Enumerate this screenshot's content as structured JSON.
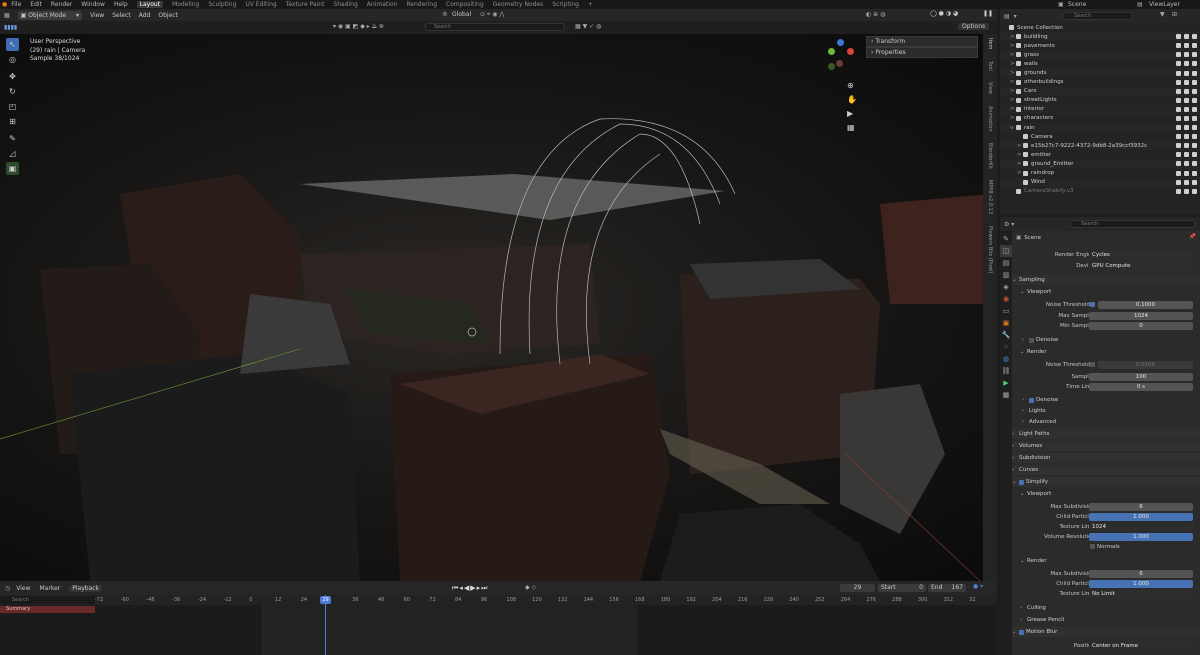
{
  "menubar": {
    "items": [
      "File",
      "Edit",
      "Render",
      "Window",
      "Help"
    ],
    "workspaces": [
      "Layout",
      "Modeling",
      "Sculpting",
      "UV Editing",
      "Texture Paint",
      "Shading",
      "Animation",
      "Rendering",
      "Compositing",
      "Geometry Nodes",
      "Scripting"
    ],
    "scene": "Scene",
    "view_layer": "ViewLayer"
  },
  "viewport": {
    "mode": "Object Mode",
    "menus": [
      "View",
      "Select",
      "Add",
      "Object"
    ],
    "orientation": "Global",
    "overlay": {
      "line1": "User Perspective",
      "line2": "(29) rain | Camera",
      "line3": "Sample 38/1024"
    },
    "options": "Options",
    "npanel": [
      "Transform",
      "Properties"
    ],
    "side_tabs": [
      "Item",
      "Tool",
      "View",
      "Animation",
      "BlenderKit",
      "MPFB v2.0.13",
      "Flowers Bits (Pixel)"
    ],
    "gizmo": {
      "x": "X",
      "y": "Y",
      "z": "Z"
    }
  },
  "timeline": {
    "menus": [
      "View",
      "Marker"
    ],
    "playback": "Playback",
    "current_frame": "29",
    "start_label": "Start",
    "start": "0",
    "end_label": "End",
    "end": "167",
    "search_placeholder": "Search",
    "summary": "Summary",
    "ticks": [
      "-72",
      "-60",
      "-48",
      "-36",
      "-24",
      "-12",
      "0",
      "12",
      "24",
      "29",
      "36",
      "48",
      "60",
      "72",
      "84",
      "96",
      "108",
      "120",
      "132",
      "144",
      "156",
      "168",
      "180",
      "192",
      "204",
      "216",
      "228",
      "240",
      "252",
      "264",
      "276",
      "288",
      "300",
      "312",
      "32"
    ]
  },
  "outliner": {
    "search_placeholder": "Search",
    "rows": [
      {
        "name": "Scene Collection",
        "indent": 0,
        "expander": "",
        "color": "#cfcfcf"
      },
      {
        "name": "buildling",
        "indent": 1,
        "expander": ">",
        "color": "#cfcfcf"
      },
      {
        "name": "pavements",
        "indent": 1,
        "expander": ">",
        "color": "#cfcfcf"
      },
      {
        "name": "grass",
        "indent": 1,
        "expander": ">",
        "color": "#cfcfcf"
      },
      {
        "name": "walls",
        "indent": 1,
        "expander": ">",
        "color": "#cfcfcf"
      },
      {
        "name": "grounds",
        "indent": 1,
        "expander": ">",
        "color": "#cfcfcf"
      },
      {
        "name": "otherbuildings",
        "indent": 1,
        "expander": ">",
        "color": "#cfcfcf"
      },
      {
        "name": "Cars",
        "indent": 1,
        "expander": ">",
        "color": "#cfcfcf"
      },
      {
        "name": "streetLights",
        "indent": 1,
        "expander": ">",
        "color": "#cfcfcf"
      },
      {
        "name": "interior",
        "indent": 1,
        "expander": ">",
        "color": "#cfcfcf"
      },
      {
        "name": "characters",
        "indent": 1,
        "expander": ">",
        "color": "#cfcfcf"
      },
      {
        "name": "rain",
        "indent": 1,
        "expander": "v",
        "color": "#cfcfcf"
      },
      {
        "name": "Camera",
        "indent": 2,
        "expander": "",
        "color": "#cfcfcf"
      },
      {
        "name": "e15b27c7-9222-4372-9db8-2a39ccf3932c",
        "indent": 2,
        "expander": ">",
        "color": "#cfcfcf"
      },
      {
        "name": "emitter",
        "indent": 2,
        "expander": ">",
        "color": "#cfcfcf"
      },
      {
        "name": "ground_Emitter",
        "indent": 2,
        "expander": ">",
        "color": "#cfcfcf"
      },
      {
        "name": "raindrop",
        "indent": 2,
        "expander": ">",
        "color": "#cfcfcf"
      },
      {
        "name": "Wind",
        "indent": 2,
        "expander": "",
        "color": "#cfcfcf"
      },
      {
        "name": "CameraShakify.v3",
        "indent": 1,
        "expander": "",
        "color": "#777"
      }
    ]
  },
  "properties": {
    "search_placeholder": "Search",
    "context": "Scene",
    "render_engine_label": "Render Engine",
    "render_engine": "Cycles",
    "device_label": "Device",
    "device": "GPU Compute",
    "sampling": "Sampling",
    "viewport": "Viewport",
    "noise_threshold_label": "Noise Threshold",
    "vp_noise_threshold": "0.1000",
    "max_samples_label": "Max Samples",
    "vp_max_samples": "1024",
    "min_samples_label": "Min Samples",
    "vp_min_samples": "0",
    "denoise": "Denoise",
    "render": "Render",
    "r_noise_threshold": "0.0100",
    "samples_label": "Samples",
    "r_samples": "100",
    "time_limit_label": "Time Limit",
    "r_time_limit": "0 s",
    "lights": "Lights",
    "advanced": "Advanced",
    "light_paths": "Light Paths",
    "volumes": "Volumes",
    "subdivision": "Subdivision",
    "curves": "Curves",
    "simplify": "Simplify",
    "max_subdivision_label": "Max Subdivision",
    "vp_max_subdivision": "6",
    "child_particles_label": "Child Particles",
    "vp_child_particles": "1.000",
    "texture_limit_label": "Texture Limit",
    "vp_texture_limit": "1024",
    "volume_resolution_label": "Volume Resolution",
    "vp_volume_resolution": "1.000",
    "normals": "Normals",
    "r_max_subdivision": "6",
    "r_child_particles": "1.000",
    "r_texture_limit": "No Limit",
    "culling": "Culling",
    "grease_pencil": "Grease Pencil",
    "motion_blur": "Motion Blur",
    "position_label": "Position",
    "position": "Center on Frame"
  },
  "colors": {
    "accent": "#4772b3",
    "playhead": "#4d7bd6",
    "summary_bg": "#6b2a2a"
  }
}
